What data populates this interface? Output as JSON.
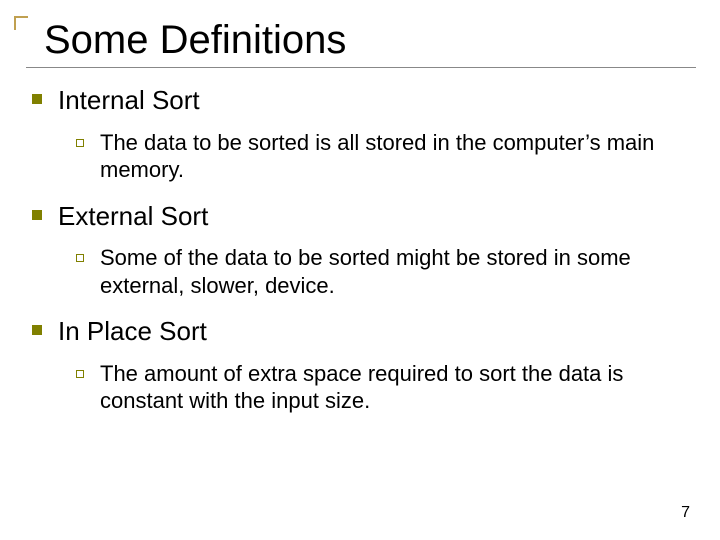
{
  "title": "Some Definitions",
  "items": [
    {
      "heading": "Internal Sort",
      "detail": "The data to be sorted is all stored in the computer’s main memory."
    },
    {
      "heading": "External Sort",
      "detail": "Some of the data to be sorted might be stored in some external, slower, device."
    },
    {
      "heading": "In Place Sort",
      "detail": "The amount of extra space required to sort the data is constant with the input size."
    }
  ],
  "page_number": "7"
}
